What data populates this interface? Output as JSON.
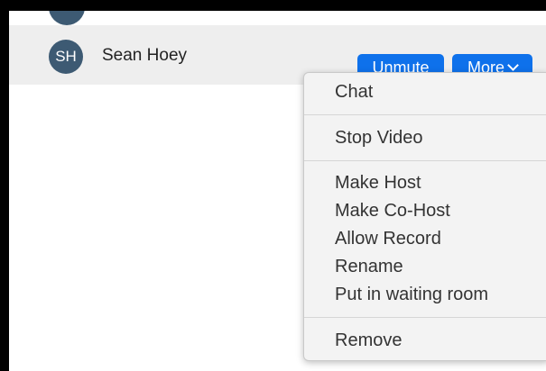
{
  "participant": {
    "initials": "SH",
    "name": "Sean Hoey",
    "avatar_color": "#3d5a73"
  },
  "buttons": {
    "unmute_label": "Unmute",
    "more_label": "More",
    "accent_color": "#0e71eb"
  },
  "menu": {
    "chat": "Chat",
    "stop_video": "Stop Video",
    "make_host": "Make Host",
    "make_cohost": "Make Co-Host",
    "allow_record": "Allow Record",
    "rename": "Rename",
    "waiting_room": "Put in waiting room",
    "remove": "Remove"
  }
}
